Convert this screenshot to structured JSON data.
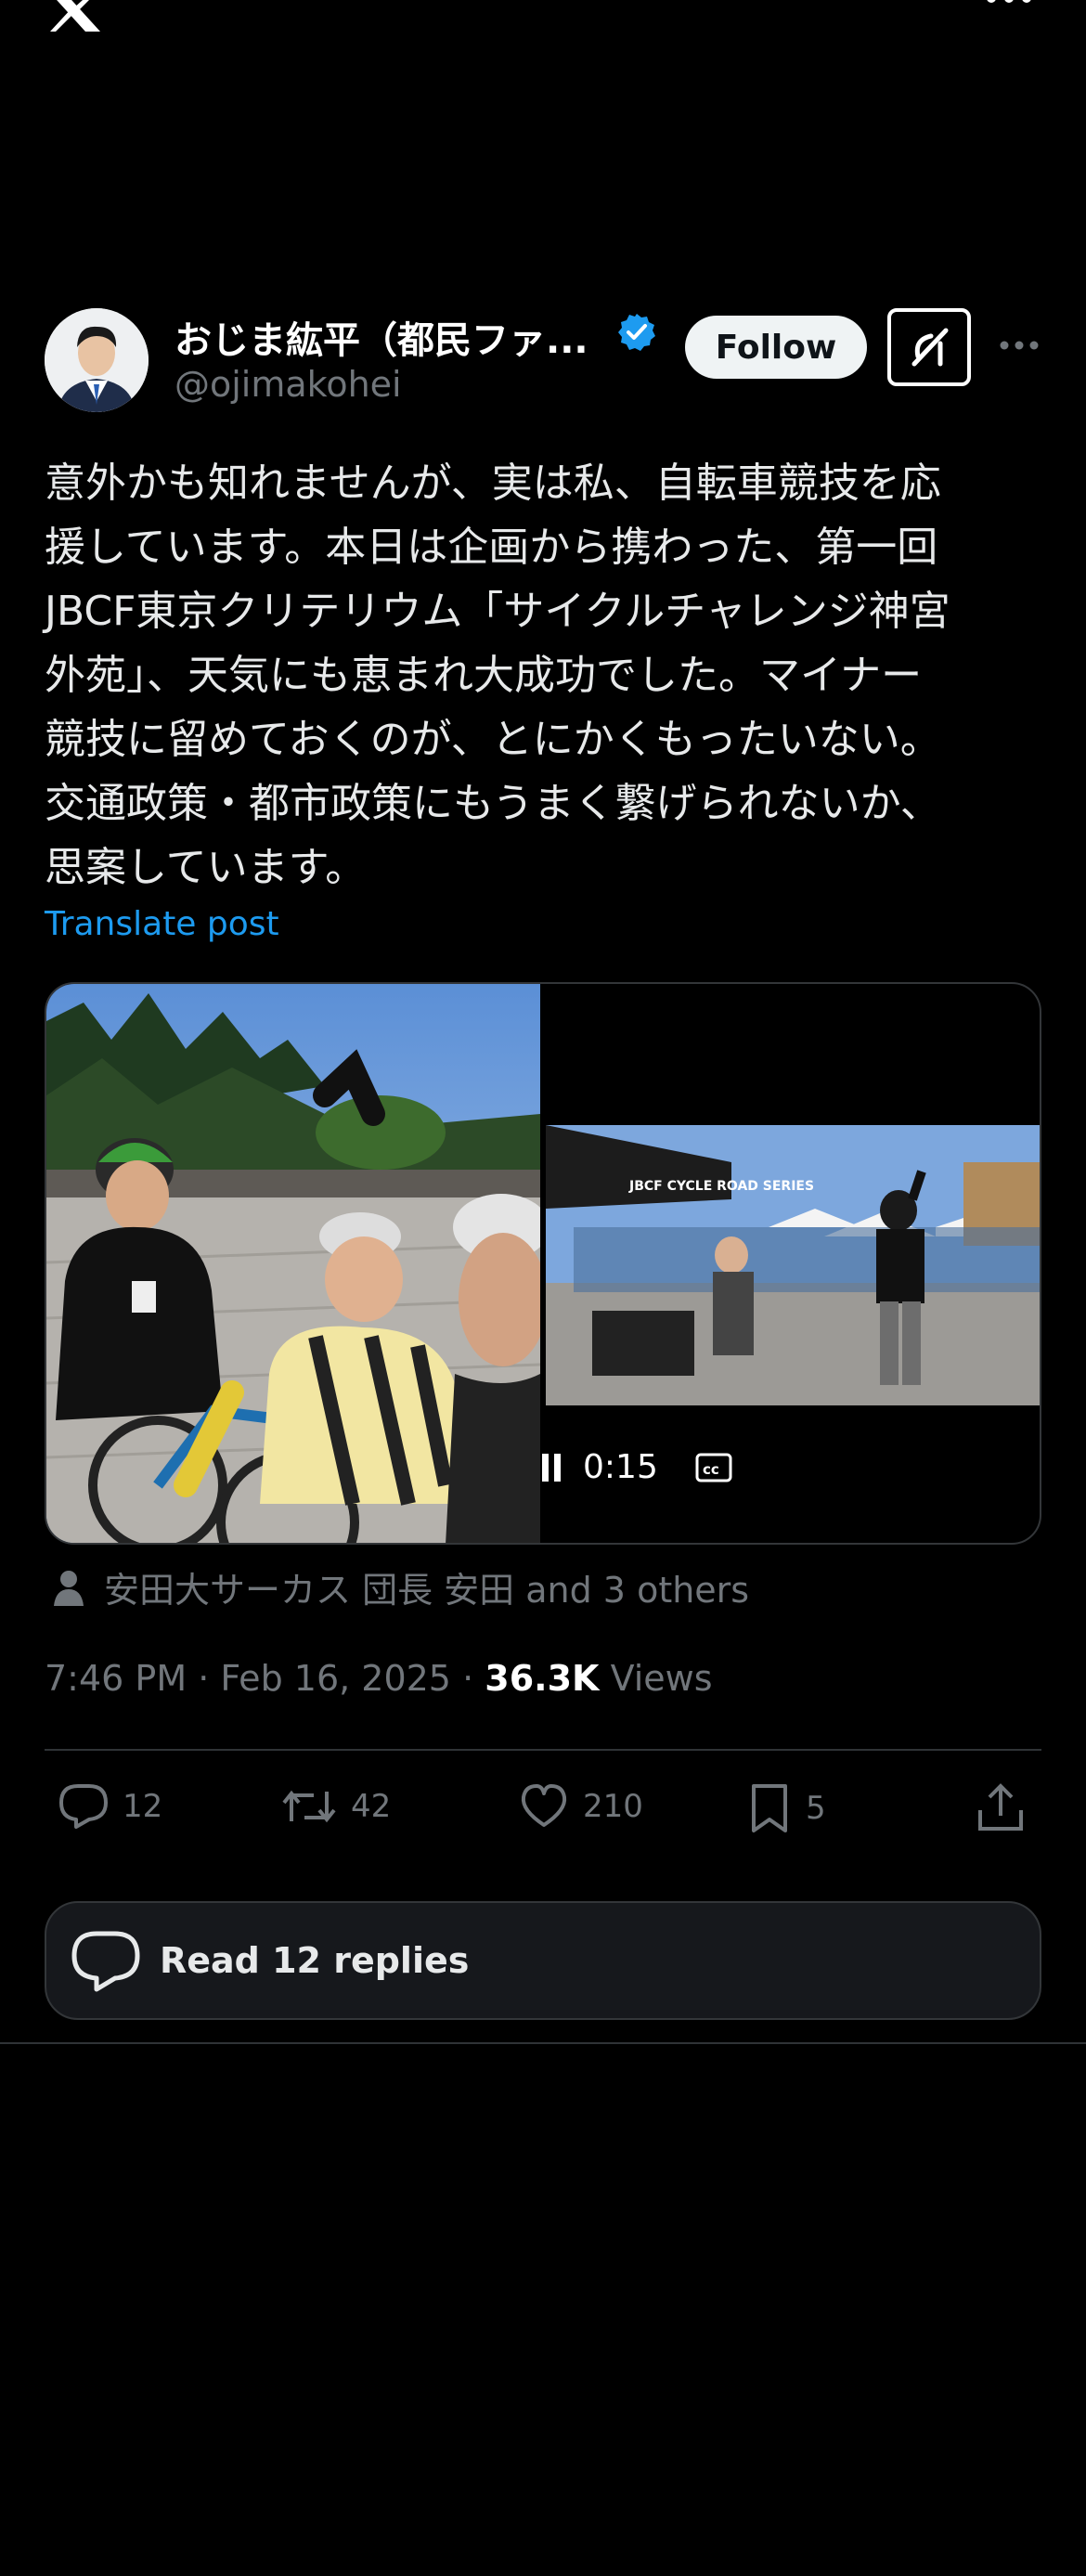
{
  "app": {
    "brand_icon": "x-logo-icon"
  },
  "author": {
    "name": "おじま紘平（都民ファ...",
    "handle": "@ojimakohei",
    "verified": true,
    "verified_color": "#1d9bf0"
  },
  "header": {
    "follow_label": "Follow",
    "grok_icon": "grok-icon",
    "more_icon": "more-horizontal-icon"
  },
  "post": {
    "text": "意外かも知れませんが、実は私、自転車競技を応\n援しています。本日は企画から携わった、第一回\nJBCF東京クリテリウム「サイクルチャレンジ神宮\n外苑」、天気にも恵まれ大成功でした。マイナー\n競技に留めておくのが、とにかくもったいない。\n交通政策・都市政策にもうまく繋げられないか、\n思案しています。",
    "translate_label": "Translate post"
  },
  "media": {
    "photo_icon": "cyclists-selfie-photo",
    "video_icon": "event-stage-video",
    "video_time": "0:15",
    "pause_icon": "pause-icon",
    "cc_icon": "closed-captions-icon",
    "banner_text": "JBCF CYCLE ROAD SERIES"
  },
  "tags": {
    "text": "安田大サーカス 団長 安田 and 3 others"
  },
  "meta": {
    "time": "7:46 PM",
    "date": "Feb 16, 2025",
    "sep": "·",
    "views_count": "36.3K",
    "views_label": "Views"
  },
  "actions": {
    "replies": "12",
    "reposts": "42",
    "likes": "210",
    "bookmarks": "5"
  },
  "read_replies": {
    "label": "Read 12 replies"
  },
  "colors": {
    "accent": "#1d9bf0",
    "background": "#000000",
    "muted": "#71767b"
  }
}
